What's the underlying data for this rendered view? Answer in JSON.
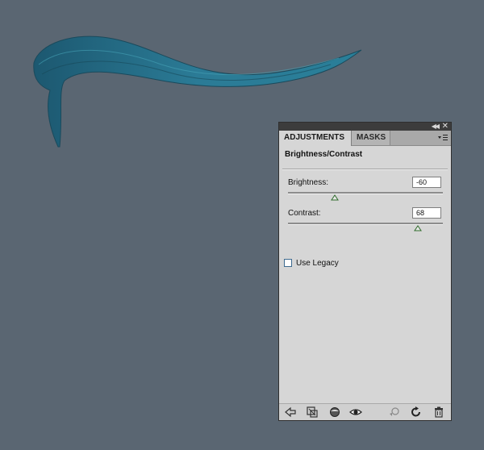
{
  "panel": {
    "tabs": [
      {
        "label": "ADJUSTMENTS",
        "active": true
      },
      {
        "label": "MASKS",
        "active": false
      }
    ],
    "section_title": "Brightness/Contrast",
    "controls": {
      "brightness": {
        "label": "Brightness:",
        "value": "-60",
        "slider_fraction": 0.3
      },
      "contrast": {
        "label": "Contrast:",
        "value": "68",
        "slider_fraction": 0.84
      }
    },
    "use_legacy": {
      "label": "Use Legacy",
      "checked": false
    },
    "bottom_icons": [
      "back-arrow-icon",
      "clip-to-layer-icon",
      "layer-visibility-toggle-icon",
      "eye-icon",
      "view-previous-state-icon",
      "reset-icon",
      "trash-icon"
    ]
  },
  "colors": {
    "background": "#5a6672",
    "panel": "#d6d6d6",
    "stroke": "#2a7a94"
  }
}
